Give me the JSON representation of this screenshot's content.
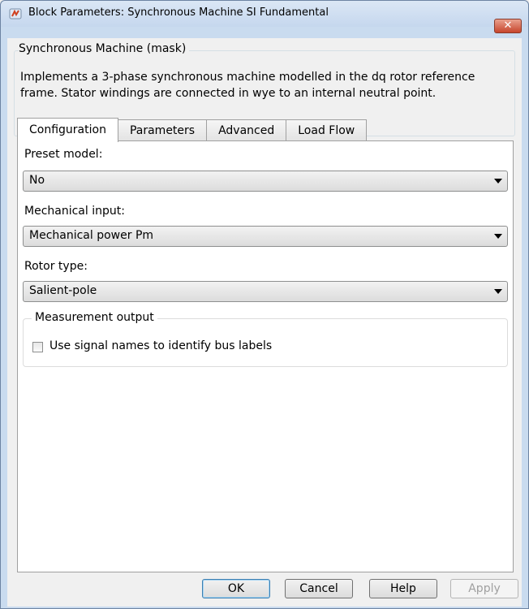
{
  "window": {
    "title": "Block Parameters: Synchronous Machine SI Fundamental",
    "close_glyph": "✕"
  },
  "section": {
    "title": "Synchronous Machine (mask)",
    "description_line1": "Implements a 3-phase synchronous machine modelled in the dq rotor reference",
    "description_line2": "frame. Stator windings are connected in wye to an internal neutral point."
  },
  "tabs": [
    {
      "label": "Configuration",
      "active": true
    },
    {
      "label": "Parameters",
      "active": false
    },
    {
      "label": "Advanced",
      "active": false
    },
    {
      "label": "Load Flow",
      "active": false
    }
  ],
  "configuration": {
    "preset_model": {
      "label": "Preset  model:",
      "value": "No"
    },
    "mechanical_input": {
      "label": "Mechanical input:",
      "value": "Mechanical power Pm"
    },
    "rotor_type": {
      "label": "Rotor type:",
      "value": "Salient-pole"
    },
    "measurement_output": {
      "title": "Measurement output",
      "checkbox_label": "Use signal names to identify bus labels",
      "checked": false
    }
  },
  "buttons": {
    "ok": "OK",
    "cancel": "Cancel",
    "help": "Help",
    "apply": "Apply"
  },
  "icons": {
    "app": "simulink-block-icon",
    "close": "close-icon",
    "dropdown": "chevron-down-icon"
  }
}
